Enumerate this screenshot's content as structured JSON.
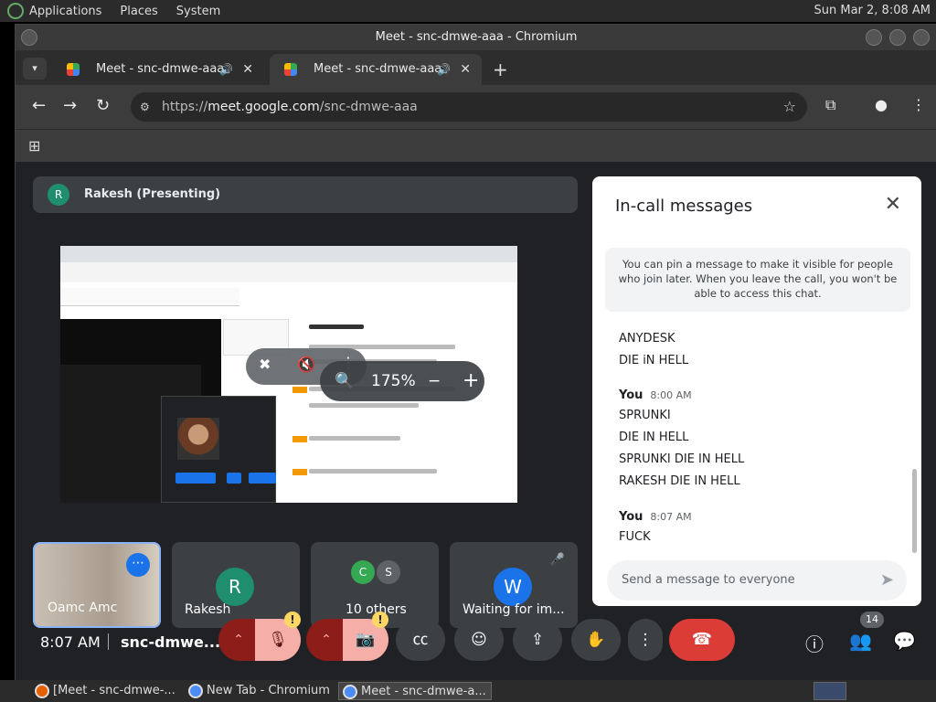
{
  "panel": {
    "menus": [
      "Applications",
      "Places",
      "System"
    ],
    "clock": "Sun Mar 2,  8:08 AM"
  },
  "window": {
    "title": "Meet - snc-dmwe-aaa - Chromium"
  },
  "tabs": [
    {
      "label": "Meet - snc-dmwe-aaa"
    },
    {
      "label": "Meet - snc-dmwe-aaa"
    }
  ],
  "address": {
    "scheme": "https://",
    "host": "meet.google.com",
    "path": "/snc-dmwe-aaa"
  },
  "presenting": {
    "initial": "R",
    "label": "Rakesh (Presenting)"
  },
  "zoom": {
    "value": "175%"
  },
  "tiles": [
    {
      "name": "Oamc Amc"
    },
    {
      "name": "Rakesh",
      "initial": "R"
    },
    {
      "name": "10 others",
      "initials": [
        "C",
        "S"
      ]
    },
    {
      "name": "Waiting for im...",
      "initial": "W"
    }
  ],
  "chat": {
    "title": "In-call messages",
    "notice": "You can pin a message to make it visible for people who join later. When you leave the call, you won't be able to access this chat.",
    "groups": [
      {
        "sender": "",
        "time": "",
        "messages": [
          "ANYDESK",
          "DIE iN HELL"
        ]
      },
      {
        "sender": "You",
        "time": "8:00 AM",
        "messages": [
          "SPRUNKI",
          "DIE IN HELL",
          "SPRUNKI DIE IN HELL",
          "RAKESH DIE IN HELL"
        ]
      },
      {
        "sender": "You",
        "time": "8:07 AM",
        "messages": [
          "FUCK"
        ]
      }
    ],
    "placeholder": "Send a message to everyone"
  },
  "bottom": {
    "clock": "8:07 AM",
    "meeting": "snc-dmwe...",
    "people_count": "14",
    "warn": "!"
  },
  "taskbar": [
    {
      "label": "[Meet - snc-dmwe-..."
    },
    {
      "label": "New Tab - Chromium"
    },
    {
      "label": "Meet - snc-dmwe-a..."
    }
  ],
  "colors": {
    "meet_bg": "#202124",
    "end_call": "#dc3c36",
    "accent": "#1a73e8",
    "mic_off": "#f6aea9"
  }
}
